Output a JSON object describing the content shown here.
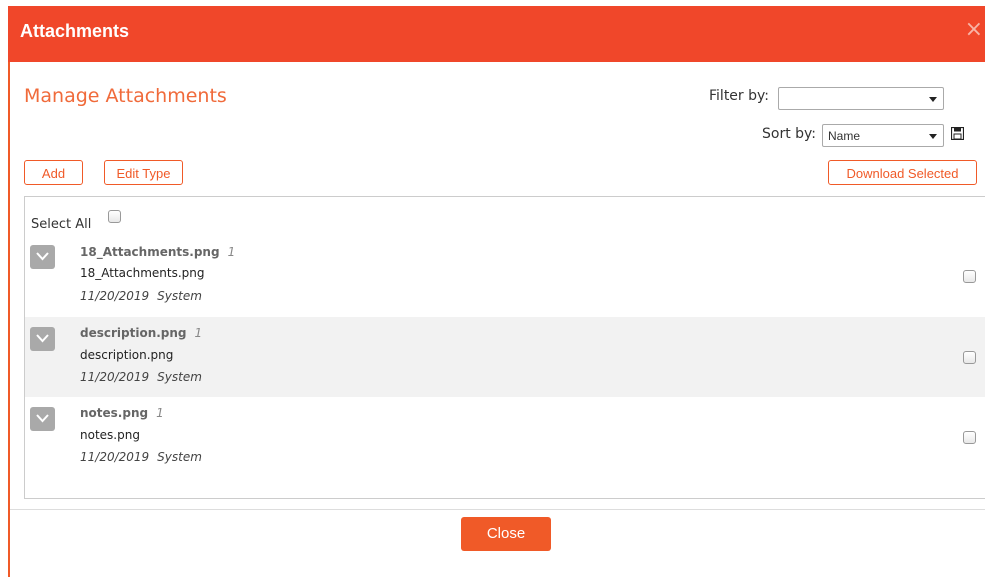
{
  "dialog": {
    "title": "Attachments",
    "close_icon": "×",
    "heading": "Manage Attachments"
  },
  "filter": {
    "label": "Filter by:",
    "value": ""
  },
  "sort": {
    "label": "Sort by:",
    "value": "Name"
  },
  "toolbar": {
    "add_label": "Add",
    "edit_type_label": "Edit Type",
    "download_label": "Download Selected"
  },
  "list": {
    "select_all_label": "Select All",
    "items": [
      {
        "name": "18_Attachments.png",
        "version": "1",
        "description": "18_Attachments.png",
        "date": "11/20/2019",
        "user": "System"
      },
      {
        "name": "description.png",
        "version": "1",
        "description": "description.png",
        "date": "11/20/2019",
        "user": "System"
      },
      {
        "name": "notes.png",
        "version": "1",
        "description": "notes.png",
        "date": "11/20/2019",
        "user": "System"
      }
    ]
  },
  "footer": {
    "close_label": "Close"
  },
  "colors": {
    "accent": "#f0472a",
    "button_border": "#f05a28",
    "title_text": "#f06a3a"
  }
}
